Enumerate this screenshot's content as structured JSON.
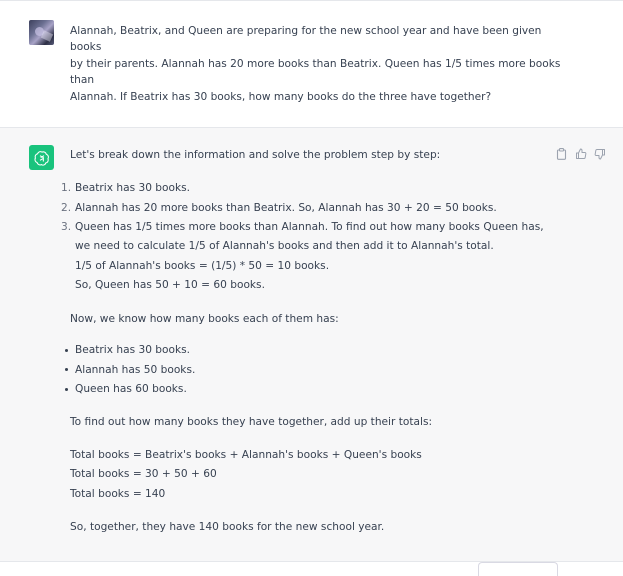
{
  "user_message": {
    "avatar": "user-avatar-image",
    "lines": [
      "Alannah, Beatrix, and Queen are preparing for the new school year and have been given",
      "books",
      "by their parents. Alannah has 20 more books than Beatrix. Queen has 1/5 times more books",
      "than",
      "Alannah. If Beatrix has 30 books, how many books do the three have together?"
    ]
  },
  "assistant_message": {
    "avatar": "chatgpt-logo-icon",
    "avatar_color": "#19c37d",
    "actions": [
      "copy-icon",
      "thumbs-up-icon",
      "thumbs-down-icon"
    ],
    "intro": "Let's break down the information and solve the problem step by step:",
    "steps": [
      {
        "num": "1.",
        "lines": [
          "Beatrix has 30 books."
        ]
      },
      {
        "num": "2.",
        "lines": [
          "Alannah has 20 more books than Beatrix. So, Alannah has 30 + 20 = 50 books."
        ]
      },
      {
        "num": "3.",
        "lines": [
          "Queen has 1/5 times more books than Alannah. To find out how many books Queen has,",
          "we need to calculate 1/5 of Alannah's books and then add it to Alannah's total.",
          "1/5 of Alannah's books = (1/5) * 50 = 10 books.",
          "So, Queen has 50 + 10 = 60 books."
        ]
      }
    ],
    "summary_intro": "Now, we know how many books each of them has:",
    "bullets": [
      "Beatrix has 30 books.",
      "Alannah has 50 books.",
      "Queen has 60 books."
    ],
    "total_intro": "To find out how many books they have together, add up their totals:",
    "calc_lines": [
      "Total books = Beatrix's books + Alannah's books + Queen's books",
      "Total books = 30 + 50 + 60",
      "Total books = 140"
    ],
    "conclusion": "So, together, they have 140 books for the new school year."
  }
}
